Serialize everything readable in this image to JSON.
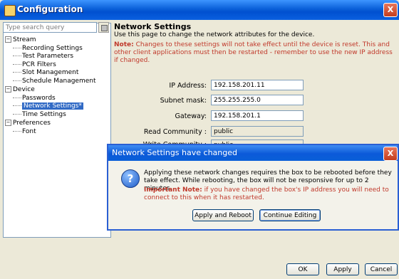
{
  "window": {
    "title": "Configuration",
    "close_glyph": "X",
    "icon": "app-config-icon"
  },
  "search": {
    "placeholder": "Type search query"
  },
  "tree": {
    "stream": "Stream",
    "stream_items": [
      "Recording Settings",
      "Test Parameters",
      "PCR Filters",
      "Slot Management",
      "Schedule Management"
    ],
    "device": "Device",
    "device_items": [
      "Passwords",
      "Network Settings*",
      "Time Settings"
    ],
    "preferences": "Preferences",
    "preferences_items": [
      "Font"
    ],
    "expanded_glyph": "−"
  },
  "panel": {
    "heading": "Network Settings",
    "description": "Use this page to change the network attributes for the device.",
    "note_label": "Note:",
    "note_text": " Changes to these settings will not take effect until the device is reset. This and other client applications must then be restarted - remember to use the new IP address if changed."
  },
  "form": {
    "ip_label": "IP Address:",
    "ip_value": "192.158.201.11",
    "subnet_label": "Subnet mask:",
    "subnet_value": "255.255.255.0",
    "gateway_label": "Gateway:",
    "gateway_value": "192.158.201.1",
    "read_label": "Read Community :",
    "read_value": "public",
    "write_label": "Write Community :",
    "write_value": "public"
  },
  "dialog": {
    "title": "Network Settings have changed",
    "close_glyph": "X",
    "icon_glyph": "?",
    "message": "Applying these network changes requires the box to be rebooted before they take effect. While rebooting, the box will not be responsive for up to 2 minutes.",
    "important_label": "Important Note:",
    "important_text": " if you have changed the box's IP address you will need to connect to this when it has restarted.",
    "apply_reboot": "Apply and Reboot",
    "continue_editing": "Continue Editing"
  },
  "buttons": {
    "ok": "OK",
    "apply": "Apply",
    "cancel": "Cancel"
  }
}
